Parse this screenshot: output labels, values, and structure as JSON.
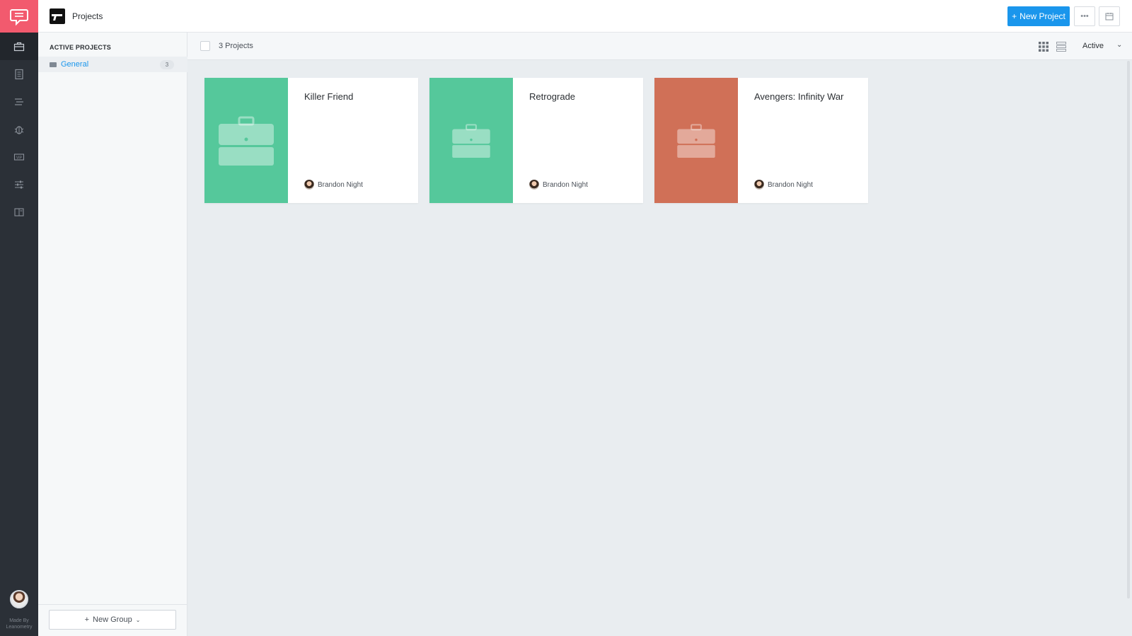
{
  "app": {
    "rail_items": [
      "projects-icon",
      "document-icon",
      "list-icon",
      "bug-icon",
      "vip-icon",
      "sliders-icon",
      "book-icon"
    ],
    "made_by": [
      "Made By",
      "Leanometry"
    ]
  },
  "topbar": {
    "title": "Projects",
    "new_project_label": "New Project",
    "accent_color": "#1a96ec"
  },
  "sidebar": {
    "heading": "ACTIVE PROJECTS",
    "items": [
      {
        "label": "General",
        "count": "3"
      }
    ],
    "new_group_label": "New Group"
  },
  "toolbar": {
    "count_text": "3 Projects",
    "status_value": "Active"
  },
  "projects": [
    {
      "title": "Killer Friend",
      "owner": "Brandon Night",
      "color": "#55c89b"
    },
    {
      "title": "Retrograde",
      "owner": "Brandon Night",
      "color": "#55c89b"
    },
    {
      "title": "Avengers: Infinity War",
      "owner": "Brandon Night",
      "color": "#d07057"
    }
  ]
}
